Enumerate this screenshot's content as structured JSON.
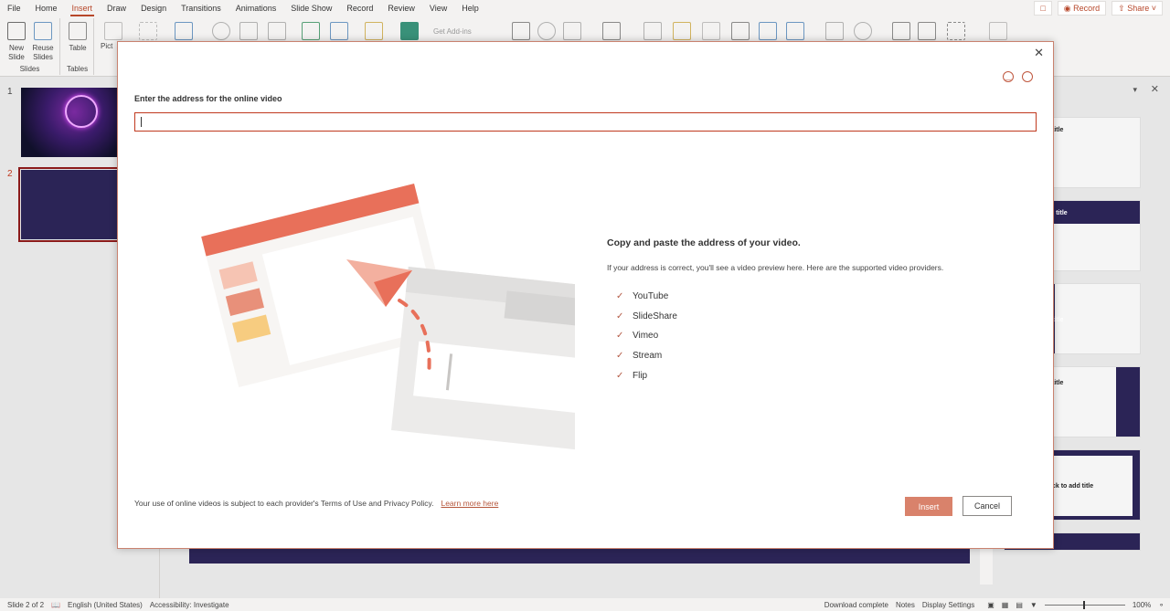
{
  "ribbon": {
    "tabs": [
      "File",
      "Home",
      "Insert",
      "Draw",
      "Design",
      "Transitions",
      "Animations",
      "Slide Show",
      "Record",
      "Review",
      "View",
      "Help"
    ],
    "active_tab": "Insert",
    "record_label": "Record",
    "share_label": "Share",
    "new_slide_label": "New Slide",
    "reuse_slides_label": "Reuse Slides",
    "table_label": "Table",
    "pictures_label": "Pict",
    "get_addins_label": "Get Add-ins",
    "group_slides": "Slides",
    "group_tables": "Tables"
  },
  "slides_pane": {
    "slides": [
      {
        "number": "1"
      },
      {
        "number": "2"
      }
    ],
    "selected": "2"
  },
  "designer": {
    "cards": [
      "title",
      "d title",
      "title",
      "title",
      "ck to add title"
    ]
  },
  "dialog": {
    "prompt": "Enter the address for the online video",
    "url_value": "",
    "heading": "Copy and paste the address of your video.",
    "subtext": "If your address is correct, you'll see a video preview here. Here are the supported video providers.",
    "providers": [
      "YouTube",
      "SlideShare",
      "Vimeo",
      "Stream",
      "Flip"
    ],
    "terms": "Your use of online videos is subject to each provider's Terms of Use and Privacy Policy.",
    "learn_more": "Learn more here",
    "insert_label": "Insert",
    "cancel_label": "Cancel",
    "accent": "#c0391e"
  },
  "status": {
    "slide_info": "Slide 2 of 2",
    "language": "English (United States)",
    "accessibility": "Accessibility: Investigate",
    "download": "Download complete",
    "notes": "Notes",
    "display_settings": "Display Settings",
    "zoom": "100%"
  }
}
